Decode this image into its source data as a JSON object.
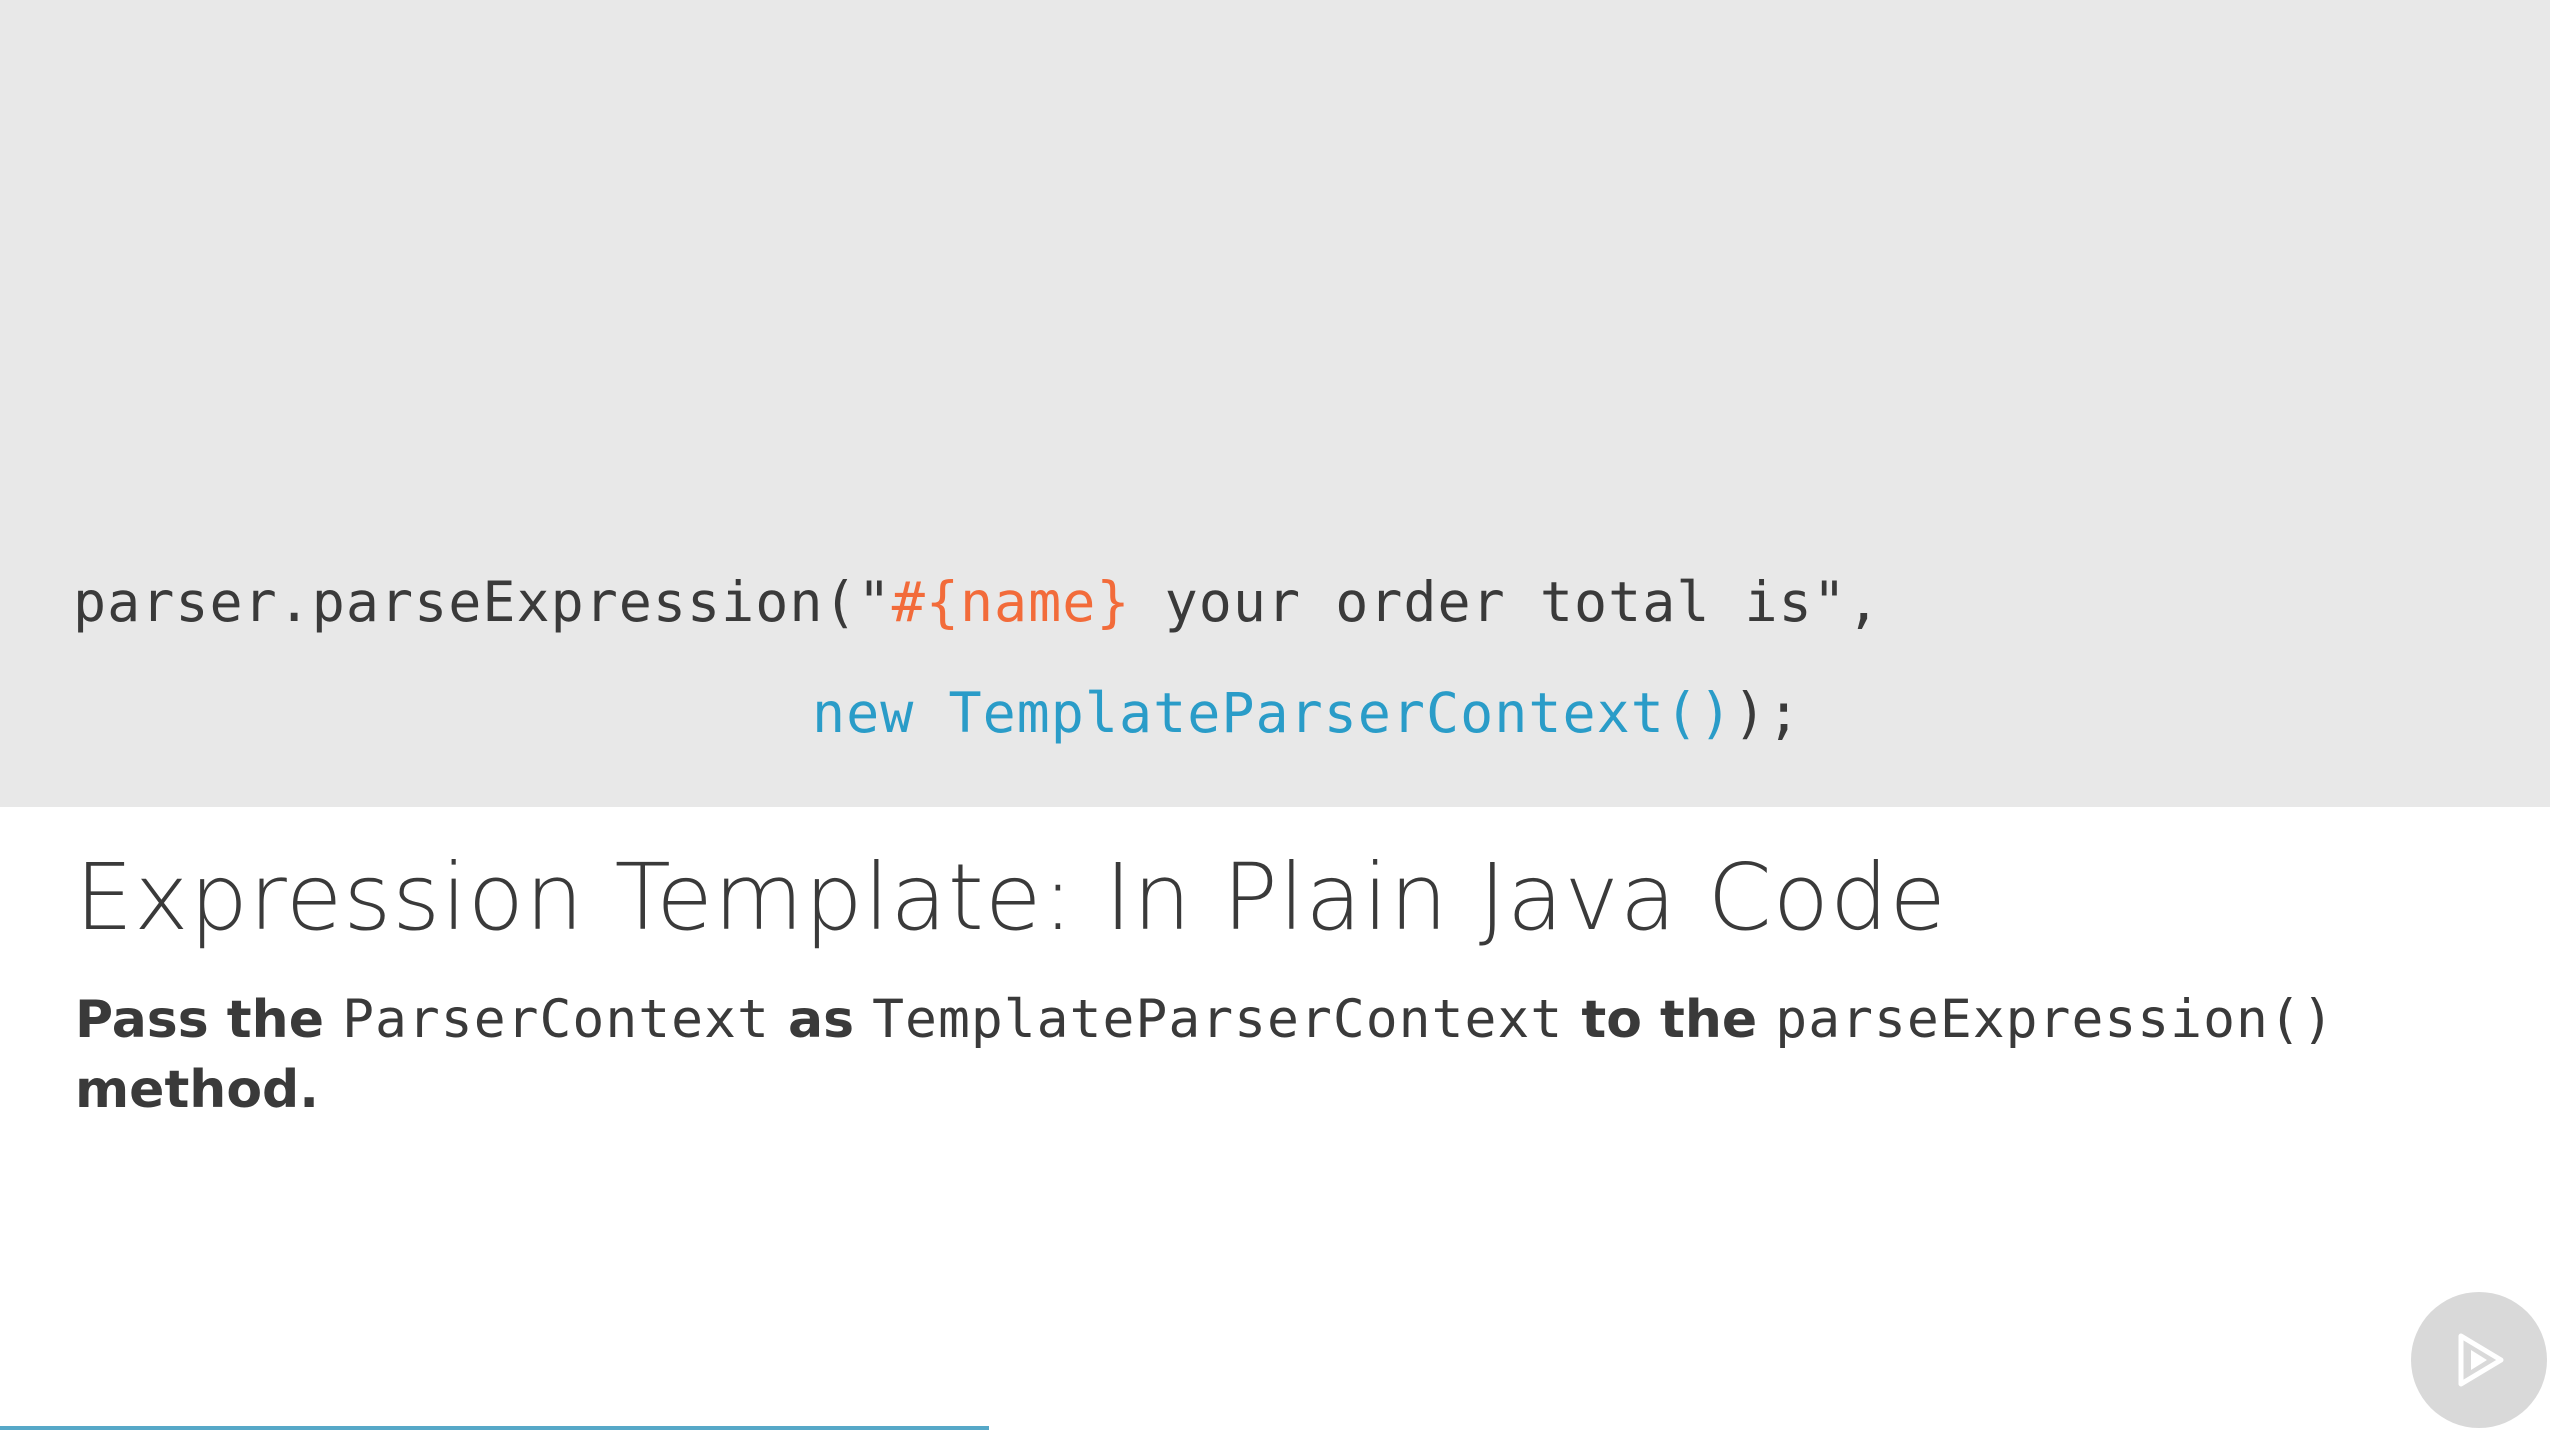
{
  "code": {
    "line1": {
      "prefix": "parser.parseExpression(\"",
      "template": "#{name}",
      "suffix": " your order total is\","
    },
    "line2": {
      "keyword": "new ",
      "class_call": "TemplateParserContext()",
      "suffix": ");"
    }
  },
  "slide": {
    "title": "Expression Template: In Plain Java Code",
    "body": {
      "part1": "Pass the ",
      "code1": "ParserContext",
      "part2": " as ",
      "code2": "TemplateParserContext",
      "part3": " to the ",
      "code3": "parseExpression()",
      "part4": " method."
    }
  },
  "player": {
    "play_icon": "play-icon",
    "progress": 0.388
  },
  "colors": {
    "code_background": "#e8e8e8",
    "template_token": "#f26b3a",
    "keyword_token": "#2a9cc8",
    "text": "#3a3a3a",
    "progress": "#56a8c8"
  }
}
